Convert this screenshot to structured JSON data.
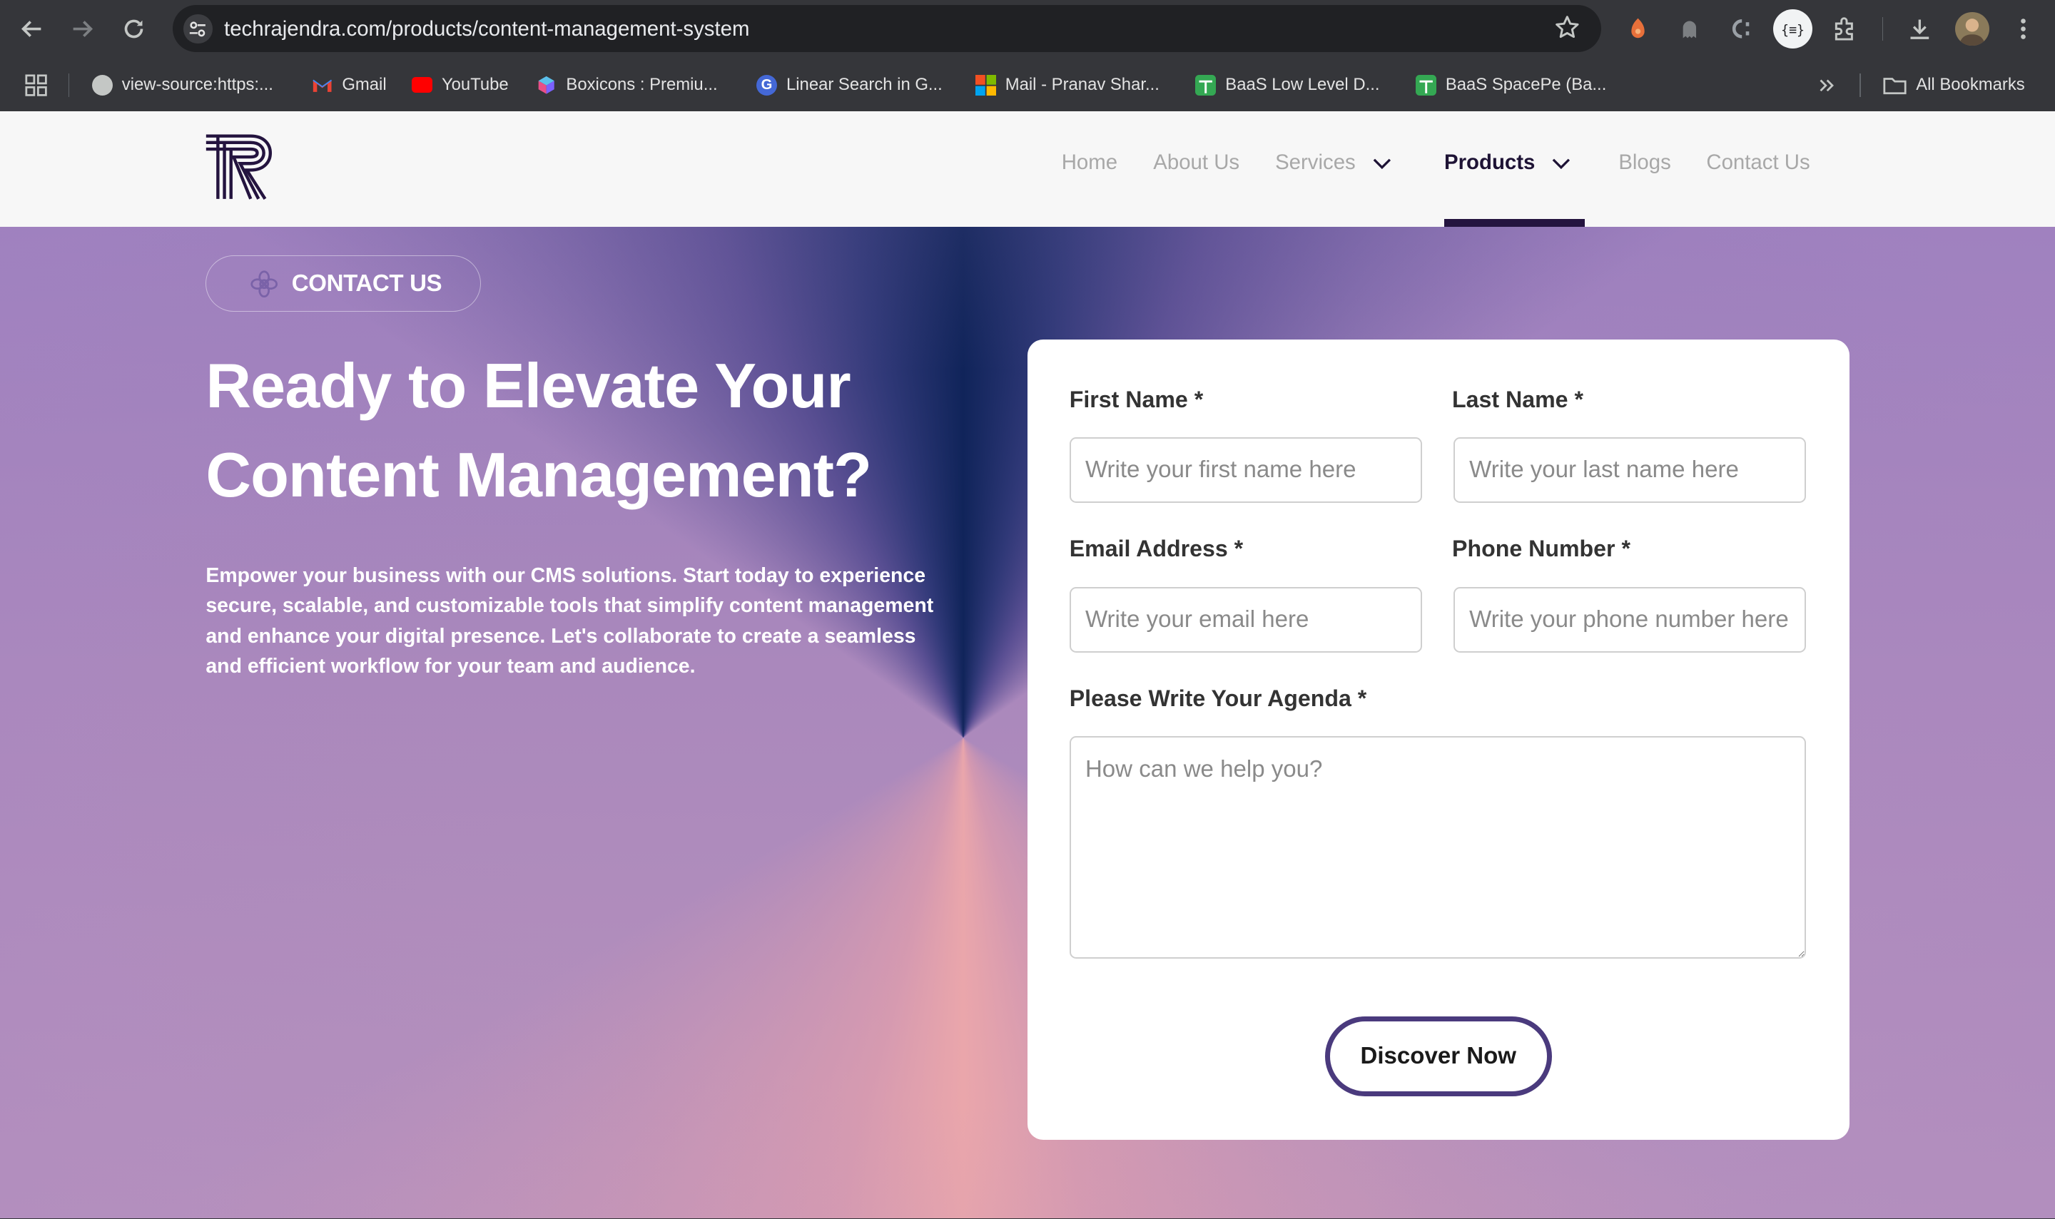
{
  "browser": {
    "url": "techrajendra.com/products/content-management-system",
    "bookmarks": [
      {
        "label": "view-source:https:...",
        "icon": "globe-icon"
      },
      {
        "label": "Gmail",
        "icon": "gmail-icon"
      },
      {
        "label": "YouTube",
        "icon": "youtube-icon"
      },
      {
        "label": "Boxicons : Premiu...",
        "icon": "boxicons-icon"
      },
      {
        "label": "Linear Search in G...",
        "icon": "google-icon"
      },
      {
        "label": "Mail - Pranav Shar...",
        "icon": "microsoft-icon"
      },
      {
        "label": "BaaS Low Level D...",
        "icon": "sheets-icon"
      },
      {
        "label": "BaaS SpacePe (Ba...",
        "icon": "sheets-icon"
      }
    ],
    "all_bookmarks": "All Bookmarks"
  },
  "nav": {
    "items": [
      {
        "label": "Home"
      },
      {
        "label": "About Us"
      },
      {
        "label": "Services"
      },
      {
        "label": "Products"
      },
      {
        "label": "Blogs"
      },
      {
        "label": "Contact Us"
      }
    ],
    "active": "Products"
  },
  "hero": {
    "pill": "CONTACT US",
    "headline_line1": "Ready to Elevate Your",
    "headline_line2": "Content Management?",
    "description": "Empower your business with our CMS solutions. Start today to experience secure, scalable, and customizable tools that simplify content management and enhance your digital presence. Let's collaborate to create a seamless and efficient workflow for your team and audience."
  },
  "form": {
    "first_name": {
      "label": "First Name *",
      "placeholder": "Write your first name here",
      "value": ""
    },
    "last_name": {
      "label": "Last Name *",
      "placeholder": "Write your last name here",
      "value": ""
    },
    "email": {
      "label": "Email Address *",
      "placeholder": "Write your email here",
      "value": ""
    },
    "phone": {
      "label": "Phone Number *",
      "placeholder": "Write your phone number here",
      "value": ""
    },
    "agenda": {
      "label": "Please Write Your Agenda *",
      "placeholder": "How can we help you?",
      "value": ""
    },
    "submit": "Discover Now"
  },
  "colors": {
    "brand_dark": "#24143f",
    "button_border": "#4a3a7d",
    "hero_purple": "#9a7ebd",
    "hero_pink": "#eaa6ab"
  }
}
